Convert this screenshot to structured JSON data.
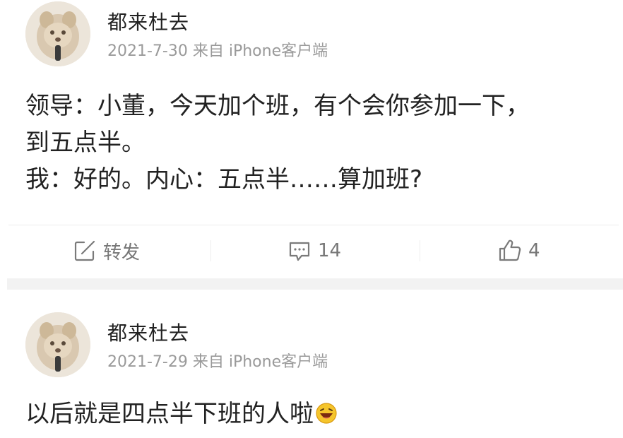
{
  "posts": [
    {
      "username": "都来杜去",
      "meta": "2021-7-30 来自 iPhone客户端",
      "content_lines": [
        "领导：小董，今天加个班，有个会你参加一下，",
        "到五点半。",
        "我：好的。内心：五点半……算加班?"
      ],
      "actions": {
        "repost_label": "转发",
        "comment_count": "14",
        "like_count": "4"
      }
    },
    {
      "username": "都来杜去",
      "meta": "2021-7-29 来自 iPhone客户端",
      "content_text": "以后就是四点半下班的人啦"
    }
  ],
  "icons": {
    "repost": "edit-share-icon",
    "comment": "comment-bubble-icon",
    "like": "thumbs-up-icon",
    "emoji": "laughing-emoji-icon"
  },
  "colors": {
    "text": "#222222",
    "meta": "#9a9a9a",
    "action": "#777777",
    "divider": "#ececec",
    "band": "#f2f2f2"
  }
}
